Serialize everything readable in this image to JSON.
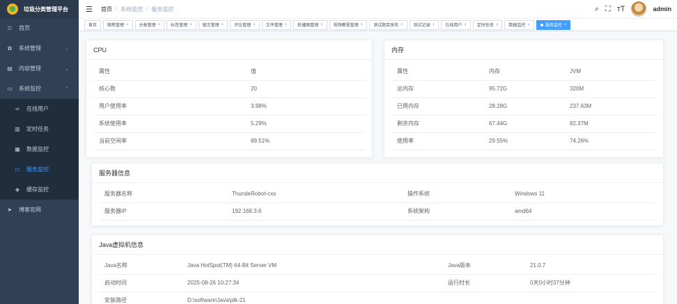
{
  "app": {
    "title": "垃圾分类管理平台"
  },
  "sidebar": {
    "items": [
      {
        "label": "首页",
        "icon": "dashboard-icon",
        "glyph": "⏲",
        "type": "top"
      },
      {
        "label": "系统管理",
        "icon": "gear-icon",
        "glyph": "✿",
        "type": "top",
        "arrow": "⌄"
      },
      {
        "label": "内容管理",
        "icon": "document-icon",
        "glyph": "▤",
        "type": "top",
        "arrow": "⌄"
      },
      {
        "label": "系统监控",
        "icon": "monitor-icon",
        "glyph": "▭",
        "type": "top",
        "arrow": "⌃"
      },
      {
        "label": "在线用户",
        "icon": "online-icon",
        "glyph": "∞",
        "type": "sub"
      },
      {
        "label": "定时任务",
        "icon": "job-icon",
        "glyph": "▥",
        "type": "sub"
      },
      {
        "label": "数据监控",
        "icon": "server-icon",
        "glyph": "▦",
        "type": "sub"
      },
      {
        "label": "服务监控",
        "icon": "server-monitor-icon",
        "glyph": "▭",
        "type": "sub",
        "active": true
      },
      {
        "label": "缓存监控",
        "icon": "cache-icon",
        "glyph": "◈",
        "type": "sub"
      },
      {
        "label": "博客官网",
        "icon": "send-icon",
        "glyph": "➤",
        "type": "top"
      }
    ]
  },
  "header": {
    "breadcrumb": [
      "首页",
      "系统监控",
      "服务监控"
    ],
    "username": "admin"
  },
  "tags": [
    {
      "label": "首页",
      "closable": false
    },
    {
      "label": "随笔管理",
      "closable": true
    },
    {
      "label": "分类管理",
      "closable": true
    },
    {
      "label": "标签管理",
      "closable": true
    },
    {
      "label": "留言管理",
      "closable": true
    },
    {
      "label": "评论管理",
      "closable": true
    },
    {
      "label": "文件管理",
      "closable": true
    },
    {
      "label": "轮播图管理",
      "closable": true
    },
    {
      "label": "视频教程管理",
      "closable": true
    },
    {
      "label": "测试题目发布",
      "closable": true
    },
    {
      "label": "测试记录",
      "closable": true
    },
    {
      "label": "在线用户",
      "closable": true
    },
    {
      "label": "定时任务",
      "closable": true
    },
    {
      "label": "数据监控",
      "closable": true
    },
    {
      "label": "服务监控",
      "closable": true,
      "active": true
    }
  ],
  "cpu": {
    "title": "CPU",
    "headers": [
      "属性",
      "值"
    ],
    "rows": [
      [
        "核心数",
        "20"
      ],
      [
        "用户使用率",
        "3.98%"
      ],
      [
        "系统使用率",
        "5.29%"
      ],
      [
        "当前空闲率",
        "89.51%"
      ]
    ]
  },
  "memory": {
    "title": "内存",
    "headers": [
      "属性",
      "内存",
      "JVM"
    ],
    "rows": [
      [
        "总内存",
        "95.72G",
        "320M"
      ],
      [
        "已用内存",
        "28.28G",
        "237.63M"
      ],
      [
        "剩余内存",
        "67.44G",
        "82.37M"
      ],
      [
        "使用率",
        "29.55%",
        "74.26%"
      ]
    ]
  },
  "server": {
    "title": "服务器信息",
    "rows": [
      [
        "服务器名称",
        "ThundeRobot-cxs",
        "操作系统",
        "Windows 11"
      ],
      [
        "服务器IP",
        "192.168.3.6",
        "系统架构",
        "amd64"
      ]
    ]
  },
  "jvm": {
    "title": "Java虚拟机信息",
    "rows": [
      [
        "Java名称",
        "Java HotSpot(TM) 64-Bit Server VM",
        "Java版本",
        "21.0.7"
      ],
      [
        "启动时间",
        "2025-08-26 10:27:34",
        "运行时长",
        "0天0小时37分钟"
      ],
      [
        "安装路径",
        "D:\\software\\Java\\jdk-21",
        "",
        ""
      ]
    ]
  },
  "colors": {
    "sidebar_bg": "#304156",
    "accent": "#409eff"
  }
}
